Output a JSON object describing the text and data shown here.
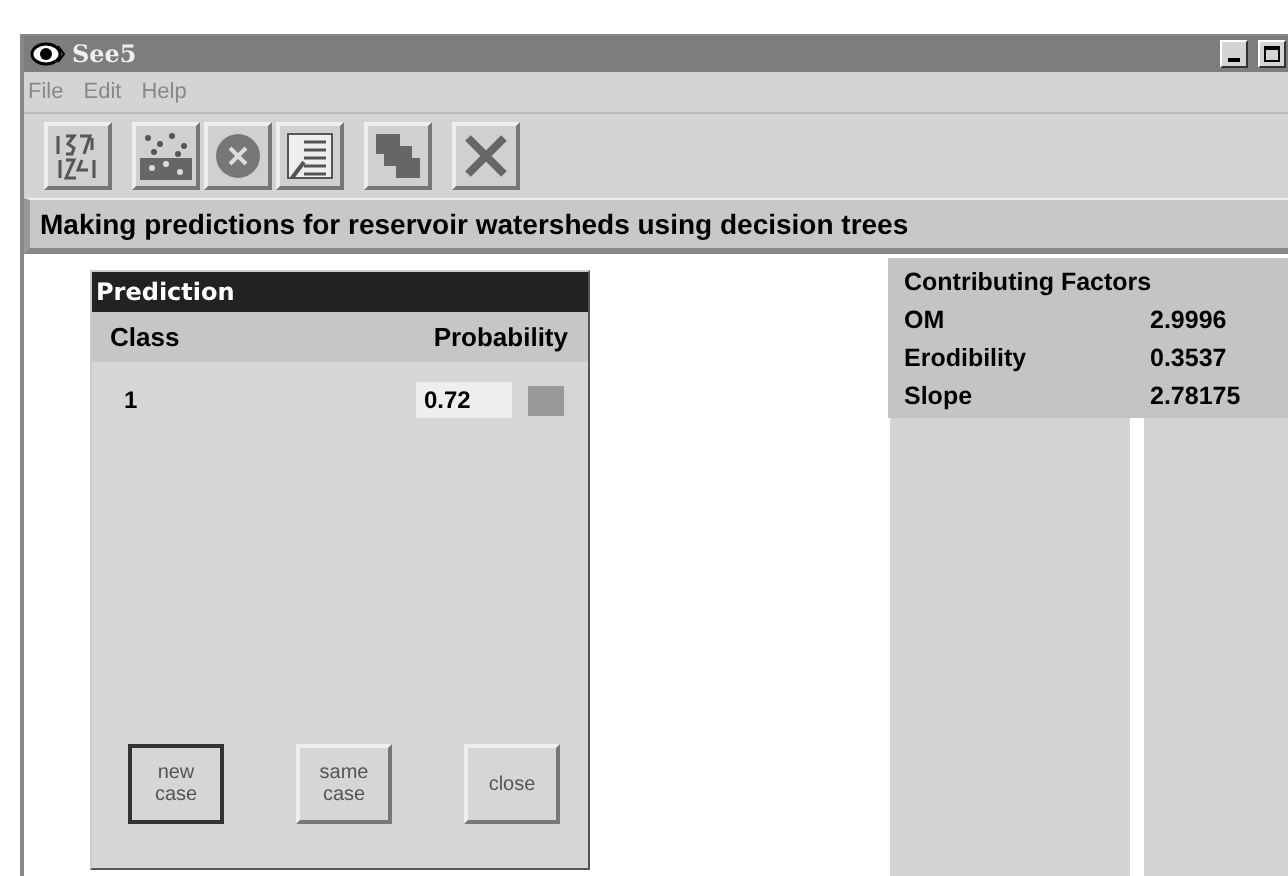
{
  "window": {
    "title": "See5"
  },
  "menu": [
    "File",
    "Edit",
    "Help"
  ],
  "toolbar": [
    {
      "kind": "numbers"
    },
    {
      "kind": "scatter"
    },
    {
      "kind": "cancel"
    },
    {
      "kind": "list"
    },
    {
      "kind": "pages"
    },
    {
      "kind": "cross"
    }
  ],
  "heading": "Making predictions for reservoir watersheds using decision trees",
  "prediction": {
    "title": "Prediction",
    "columns": [
      "Class",
      "Probability"
    ],
    "rows": [
      {
        "class": "1",
        "probability": "0.72"
      }
    ],
    "buttons": [
      {
        "label": "new case",
        "default": true
      },
      {
        "label": "same case",
        "default": false
      },
      {
        "label": "close",
        "default": false
      }
    ]
  },
  "factors": {
    "title": "Contributing Factors",
    "rows": [
      {
        "name": "OM",
        "value": "2.9996"
      },
      {
        "name": "Erodibility",
        "value": "0.3537"
      },
      {
        "name": "Slope",
        "value": "2.78175"
      }
    ]
  }
}
